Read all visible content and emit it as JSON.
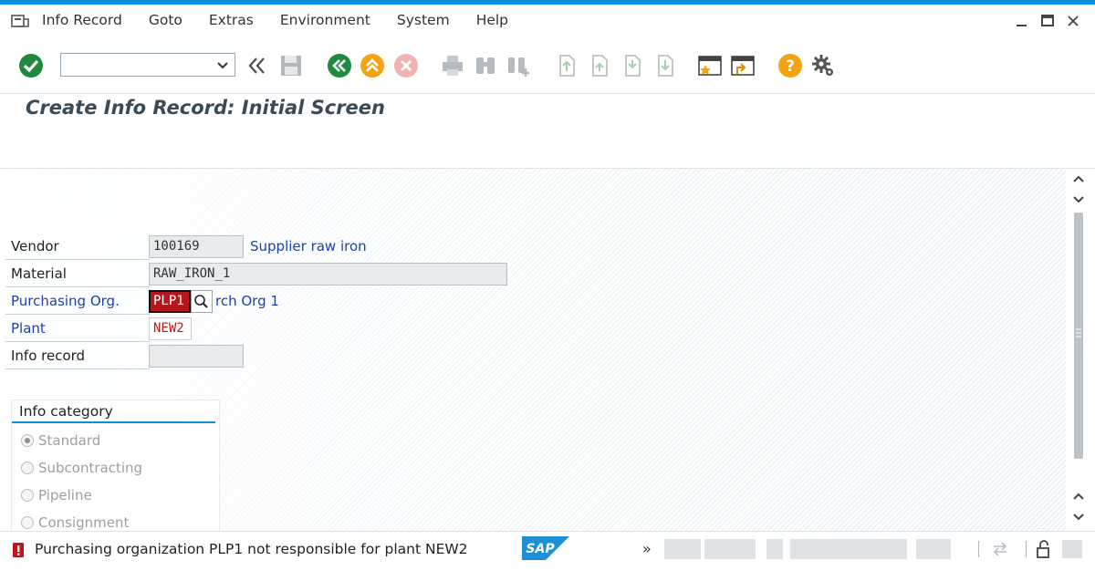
{
  "menu": {
    "items": [
      "Info Record",
      "Goto",
      "Extras",
      "Environment",
      "System",
      "Help"
    ]
  },
  "toolbar": {
    "command_value": "",
    "icons": [
      "enter-check-icon",
      "history-back-icon",
      "save-icon",
      "back-icon",
      "exit-icon",
      "cancel-icon",
      "print-icon",
      "find-icon",
      "find-next-icon",
      "first-page-icon",
      "previous-page-icon",
      "next-page-icon",
      "last-page-icon",
      "create-session-icon",
      "generate-shortcut-icon",
      "help-icon",
      "customize-layout-icon"
    ]
  },
  "title": "Create Info Record: Initial Screen",
  "form": {
    "vendor": {
      "label": "Vendor",
      "value": "100169",
      "description": "Supplier raw iron"
    },
    "material": {
      "label": "Material",
      "value": "RAW_IRON_1"
    },
    "purchasing_org": {
      "label": "Purchasing Org.",
      "value": "PLP1",
      "description": "rch Org 1"
    },
    "plant": {
      "label": "Plant",
      "value": "NEW2"
    },
    "info_record": {
      "label": "Info record",
      "value": ""
    }
  },
  "info_category": {
    "title": "Info category",
    "options": [
      "Standard",
      "Subcontracting",
      "Pipeline",
      "Consignment"
    ],
    "selected": "Standard"
  },
  "status": {
    "type": "error",
    "message": "Purchasing organization PLP1 not responsible for plant NEW2",
    "logo": "SAP",
    "more": "»"
  },
  "colors": {
    "accent": "#0a8fd8",
    "error": "#c0141c",
    "link": "#1f3fb0"
  }
}
